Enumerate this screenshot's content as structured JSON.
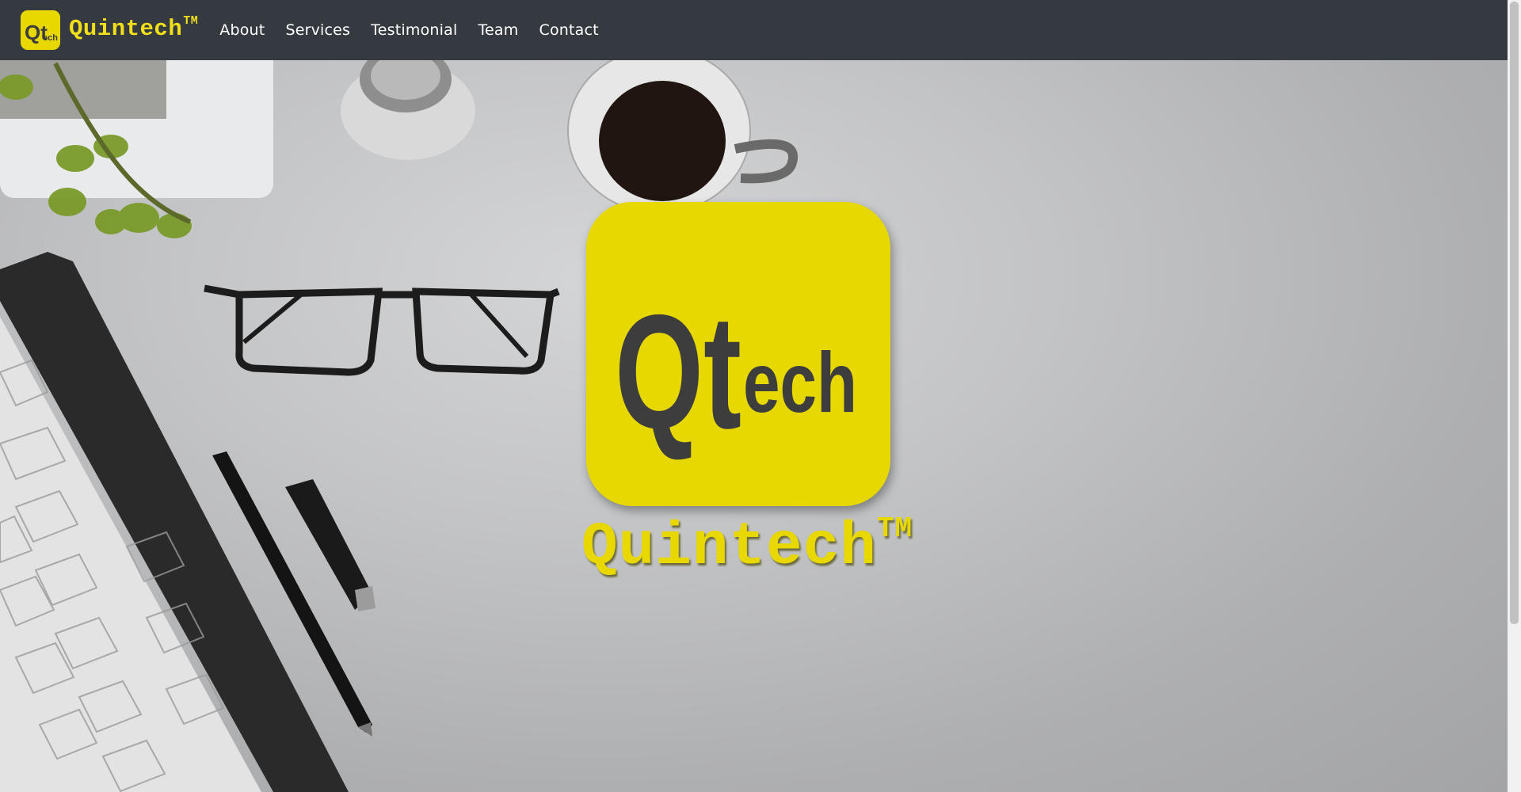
{
  "navbar": {
    "brand_name": "Quintech",
    "brand_tm": "TM",
    "logo_q": "Qt",
    "logo_ech": "ech",
    "links": [
      {
        "label": "About"
      },
      {
        "label": "Services"
      },
      {
        "label": "Testimonial"
      },
      {
        "label": "Team"
      },
      {
        "label": "Contact"
      }
    ]
  },
  "hero": {
    "logo_q": "Qt",
    "logo_ech": "ech",
    "title": "Quintech",
    "title_tm": "TM"
  },
  "colors": {
    "navbar_bg": "#343a40",
    "brand_yellow": "#e8d800",
    "logo_text": "#3d3d3d",
    "nav_text": "#ffffff"
  }
}
